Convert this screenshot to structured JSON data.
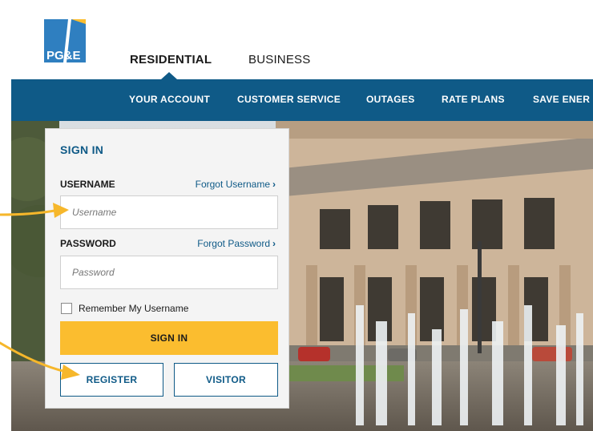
{
  "header": {
    "logo_text": "PG&E",
    "tabs": [
      {
        "label": "RESIDENTIAL",
        "active": true
      },
      {
        "label": "BUSINESS",
        "active": false
      }
    ]
  },
  "nav": {
    "items": [
      {
        "label": "YOUR ACCOUNT"
      },
      {
        "label": "CUSTOMER SERVICE"
      },
      {
        "label": "OUTAGES"
      },
      {
        "label": "RATE PLANS"
      },
      {
        "label": "SAVE ENER"
      }
    ]
  },
  "signin": {
    "title": "SIGN IN",
    "username_label": "USERNAME",
    "forgot_username": "Forgot Username",
    "username_placeholder": "Username",
    "password_label": "PASSWORD",
    "forgot_password": "Forgot Password",
    "password_placeholder": "Password",
    "remember_label": "Remember My Username",
    "signin_button": "SIGN IN",
    "register_button": "REGISTER",
    "visitor_button": "VISITOR"
  },
  "colors": {
    "brand_blue": "#0f5a87",
    "accent_yellow": "#fbbd2f",
    "annotation_arrow": "#f6b72b"
  }
}
